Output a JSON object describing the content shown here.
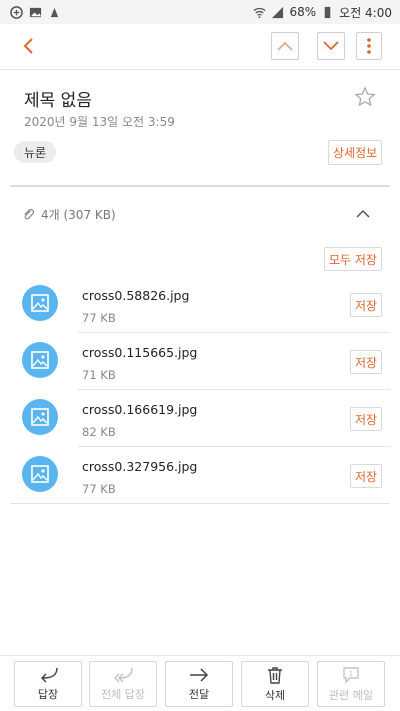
{
  "status_bar": {
    "battery": "68%",
    "time": "오전 4:00"
  },
  "header": {
    "subject": "제목 없음",
    "date": "2020년 9월 13일  오전 3:59",
    "folder": "뉴론",
    "details_label": "상세정보"
  },
  "attachments": {
    "summary": "4개 (307 KB)",
    "save_all_label": "모두 저장",
    "items": [
      {
        "name": "cross0.58826.jpg",
        "size": "77 KB",
        "save_label": "저장"
      },
      {
        "name": "cross0.115665.jpg",
        "size": "71 KB",
        "save_label": "저장"
      },
      {
        "name": "cross0.166619.jpg",
        "size": "82 KB",
        "save_label": "저장"
      },
      {
        "name": "cross0.327956.jpg",
        "size": "77 KB",
        "save_label": "저장"
      }
    ]
  },
  "bottom_bar": {
    "reply": "답장",
    "reply_all": "전체 답장",
    "forward": "전달",
    "delete": "삭제",
    "related": "관련 메일"
  },
  "colors": {
    "accent": "#e0662f",
    "thumb": "#5ab4ee"
  }
}
